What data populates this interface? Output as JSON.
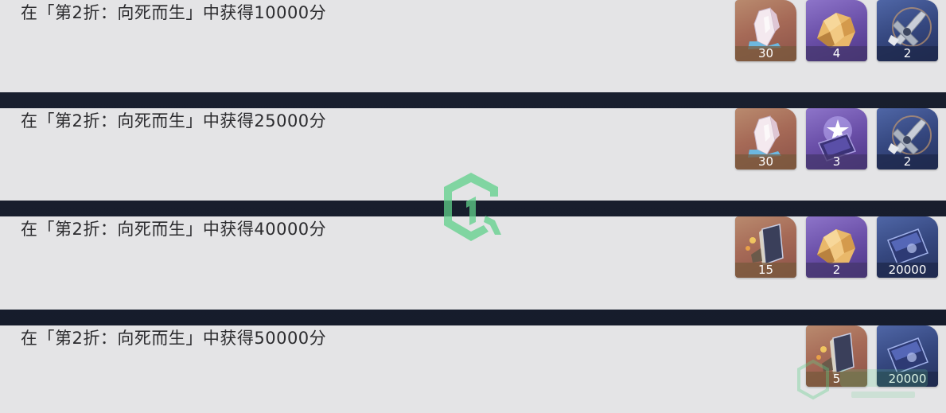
{
  "tasks": [
    {
      "label": "在「第2折：向死而生」中获得10000分",
      "rewards": [
        {
          "icon": "crystal-icon",
          "count": "30",
          "rarity_color": "#a66a57"
        },
        {
          "icon": "gold-ore-icon",
          "count": "4",
          "rarity_color": "#6a4fa8"
        },
        {
          "icon": "wrench-icon",
          "count": "2",
          "rarity_color": "#35477f"
        }
      ]
    },
    {
      "label": "在「第2折：向死而生」中获得25000分",
      "rewards": [
        {
          "icon": "crystal-icon",
          "count": "30",
          "rarity_color": "#a66a57"
        },
        {
          "icon": "star-card-icon",
          "count": "3",
          "rarity_color": "#6a4fa8"
        },
        {
          "icon": "wrench-icon",
          "count": "2",
          "rarity_color": "#35477f"
        }
      ]
    },
    {
      "label": "在「第2折：向死而生」中获得40000分",
      "rewards": [
        {
          "icon": "book-icon",
          "count": "15",
          "rarity_color": "#a66a57"
        },
        {
          "icon": "gold-ore-icon",
          "count": "2",
          "rarity_color": "#6a4fa8"
        },
        {
          "icon": "credit-card-icon",
          "count": "20000",
          "rarity_color": "#35477f"
        }
      ]
    },
    {
      "label": "在「第2折：向死而生」中获得50000分",
      "rewards": [
        {
          "icon": "book-icon",
          "count": "5",
          "rarity_color": "#a66a57"
        },
        {
          "icon": "credit-card-icon",
          "count": "20000",
          "rarity_color": "#35477f"
        }
      ]
    }
  ]
}
